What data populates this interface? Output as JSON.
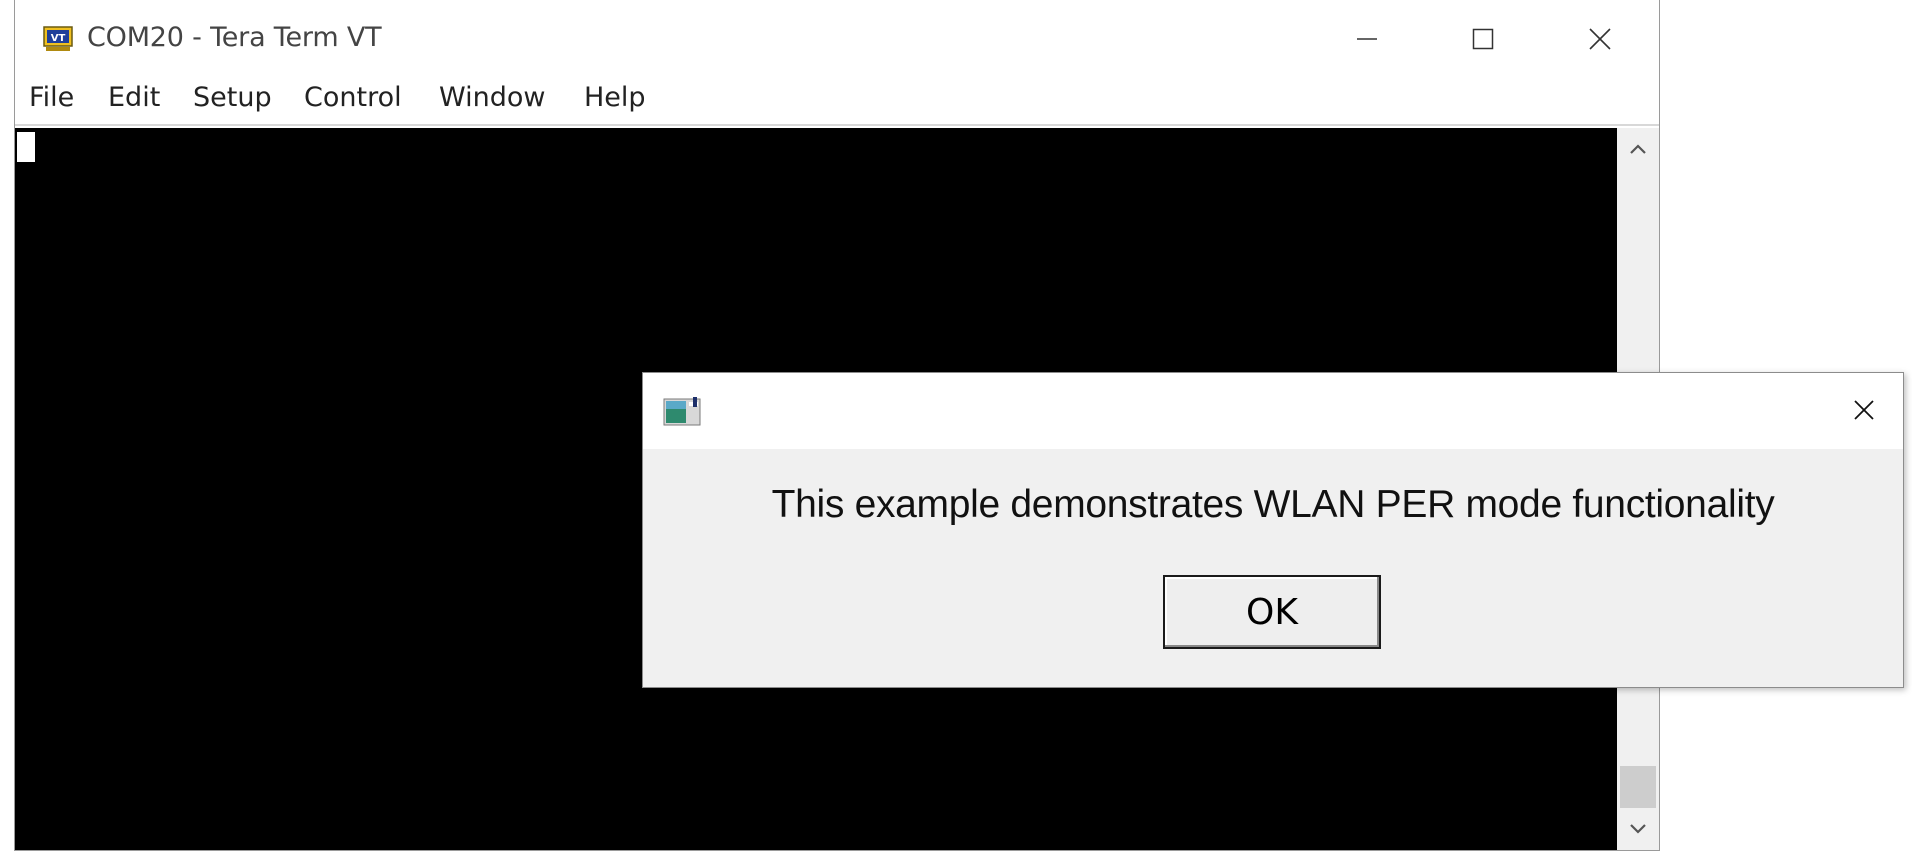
{
  "window": {
    "title": "COM20 - Tera Term VT",
    "app_icon": "vt-icon",
    "controls": [
      "minimize-icon",
      "maximize-icon",
      "close-icon"
    ]
  },
  "menu": {
    "items": [
      {
        "label": "File"
      },
      {
        "label": "Edit"
      },
      {
        "label": "Setup"
      },
      {
        "label": "Control"
      },
      {
        "label": "Window"
      },
      {
        "label": "Help"
      }
    ]
  },
  "terminal": {
    "background": "#000000",
    "cursor_color": "#ffffff"
  },
  "dialog": {
    "message": "This example demonstrates WLAN PER mode functionality",
    "ok_label": "OK",
    "icon": "app-window-icon"
  }
}
